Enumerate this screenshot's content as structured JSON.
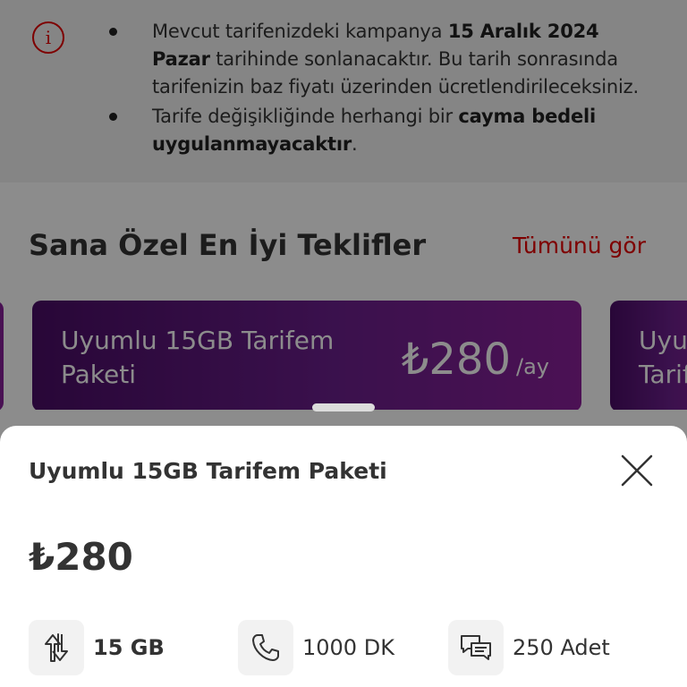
{
  "info": {
    "bullets": [
      {
        "parts": [
          {
            "text": "Mevcut tarifenizdeki kampanya ",
            "bold": false
          },
          {
            "text": "15 Aralık 2024 Pazar",
            "bold": true
          },
          {
            "text": " tarihinde sonlanacaktır. Bu tarih sonrasında tarifenizin baz fiyatı üzerinden ücretlendirileceksiniz.",
            "bold": false
          }
        ]
      },
      {
        "parts": [
          {
            "text": "Tarife değişikliğinde herhangi bir ",
            "bold": false
          },
          {
            "text": "cayma bedeli uygulanmayacaktır",
            "bold": true
          },
          {
            "text": ".",
            "bold": false
          }
        ]
      }
    ],
    "icon": "info-icon",
    "icon_glyph": "i"
  },
  "offers": {
    "title": "Sana Özel En İyi Teklifler",
    "see_all": "Tümünü gör",
    "cards": [
      {
        "name": "Uyumlu 15GB Tarifem Paketi",
        "price": "₺280",
        "period": "/ay"
      },
      {
        "name": "Uyu\nTarif"
      }
    ]
  },
  "sheet": {
    "title": "Uyumlu 15GB Tarifem Paketi",
    "price": "₺280",
    "features": [
      {
        "icon": "data-transfer-icon",
        "label": "15 GB"
      },
      {
        "icon": "phone-icon",
        "label": "1000 DK"
      },
      {
        "icon": "message-icon",
        "label": "250 Adet"
      }
    ]
  },
  "colors": {
    "accent": "#e60000",
    "card_gradient_start": "#4a0d66",
    "card_gradient_end": "#8a1f9a",
    "text": "#333333"
  }
}
